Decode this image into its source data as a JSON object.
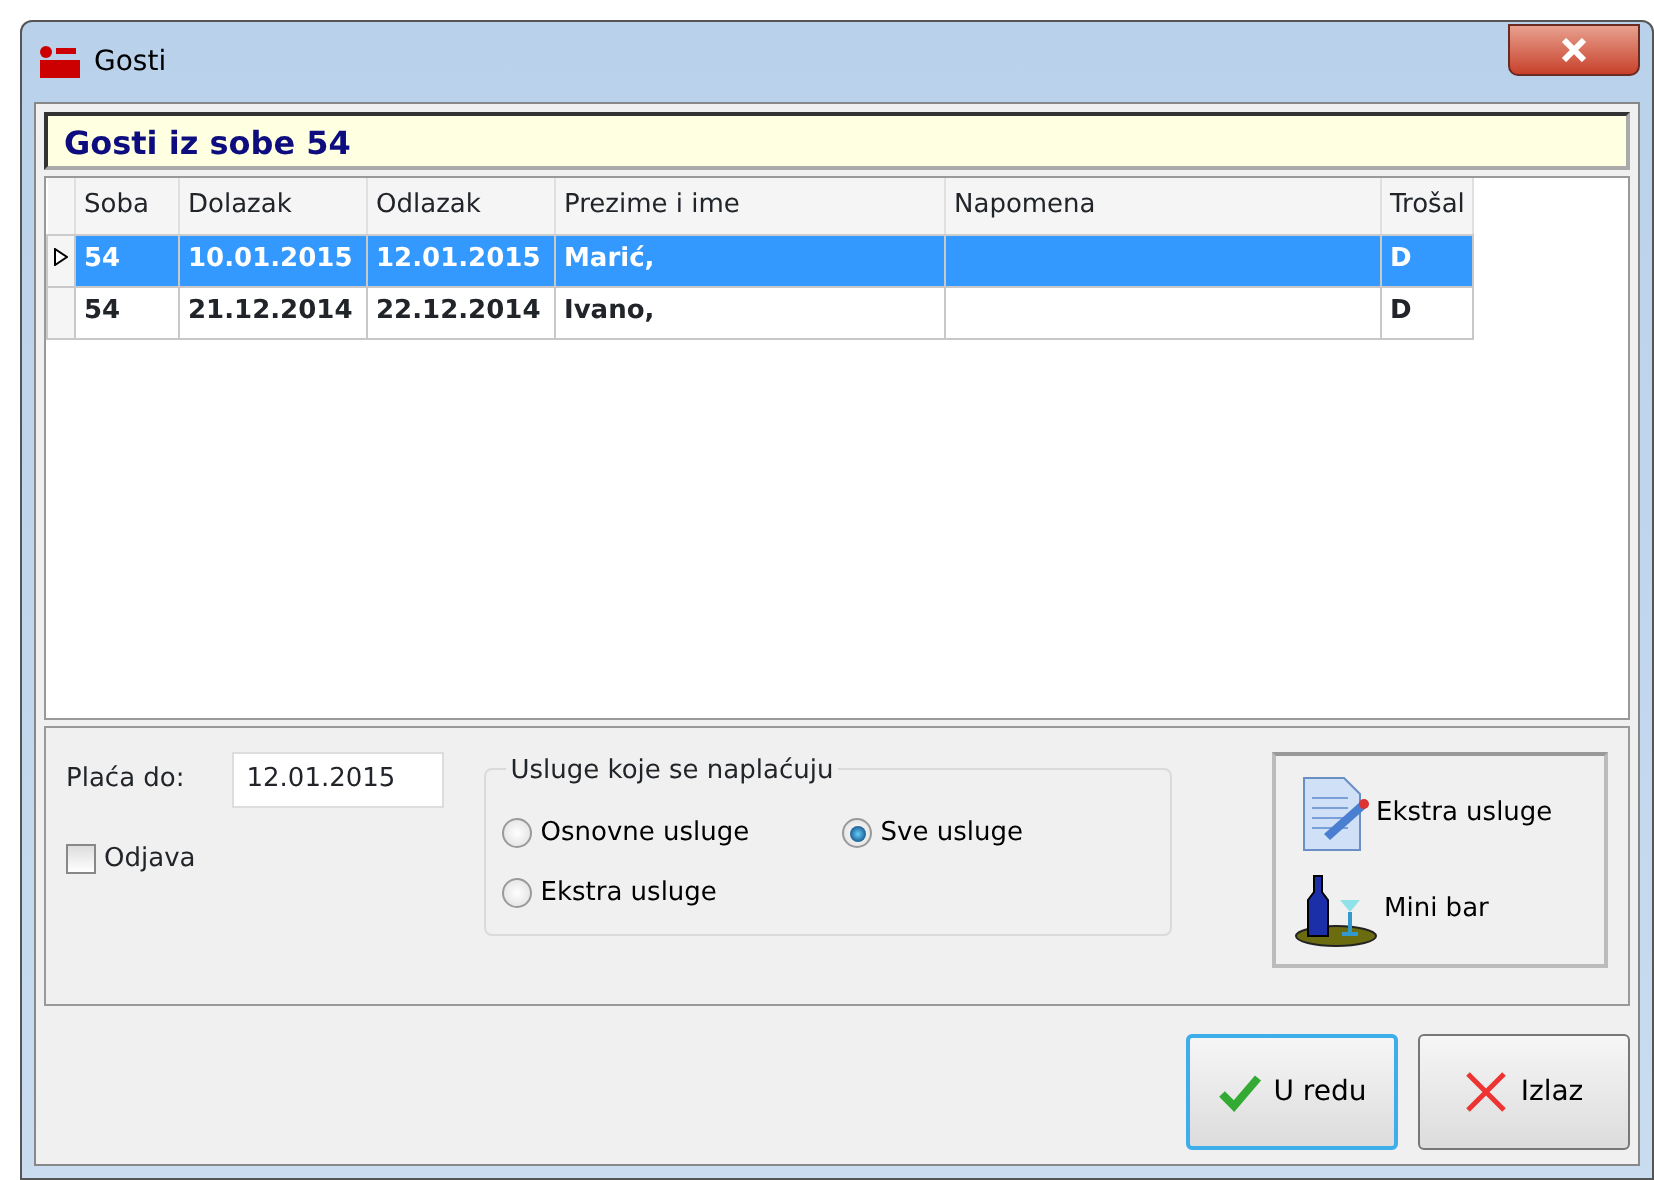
{
  "window": {
    "title": "Gosti"
  },
  "header": "Gosti iz sobe 54",
  "table": {
    "columns": [
      "Soba",
      "Dolazak",
      "Odlazak",
      "Prezime i ime",
      "Napomena",
      "Trošal"
    ],
    "rows": [
      {
        "selected": true,
        "cells": [
          "54",
          "10.01.2015",
          "12.01.2015",
          "Marić,",
          "",
          "D"
        ]
      },
      {
        "selected": false,
        "cells": [
          "54",
          "21.12.2014",
          "22.12.2014",
          "Ivano,",
          "",
          "D"
        ]
      }
    ]
  },
  "paid_until": {
    "label": "Plaća do:",
    "value": "12.01.2015"
  },
  "checkout": {
    "label": "Odjava",
    "checked": false
  },
  "services": {
    "title": "Usluge koje se naplaćuju",
    "options": [
      {
        "label": "Osnovne usluge",
        "selected": false
      },
      {
        "label": "Sve usluge",
        "selected": true
      },
      {
        "label": "Ekstra usluge",
        "selected": false
      }
    ]
  },
  "side_buttons": [
    {
      "kind": "document",
      "label": "Ekstra usluge"
    },
    {
      "kind": "minibar",
      "label": "Mini bar"
    }
  ],
  "buttons": [
    {
      "kind": "ok",
      "label": "U redu",
      "default": true
    },
    {
      "kind": "cancel",
      "label": "Izlaz",
      "default": false
    }
  ]
}
